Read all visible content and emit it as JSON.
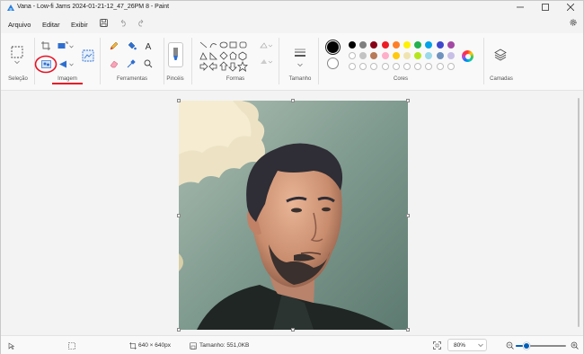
{
  "window": {
    "title": "Vana - Low-fi Jams 2024-01-21-12_47_26PM 8 - Paint"
  },
  "menu": {
    "file": "Arquivo",
    "edit": "Editar",
    "view": "Exibir"
  },
  "ribbon": {
    "groups": {
      "selection": "Seleção",
      "image": "Imagem",
      "tools": "Ferramentas",
      "brushes": "Pincéis",
      "shapes": "Formas",
      "size": "Tamanho",
      "colors": "Cores",
      "layers": "Camadas"
    },
    "text_tool_glyph": "A"
  },
  "palette": {
    "primary": "#000000",
    "secondary": "#ffffff",
    "row1": [
      "#000000",
      "#7f7f7f",
      "#880015",
      "#ed1c24",
      "#ff7f27",
      "#fff200",
      "#22b14c",
      "#00a2e8",
      "#3f48cc",
      "#a349a4"
    ],
    "row2": [
      "#ffffff",
      "#c3c3c3",
      "#b97a57",
      "#ffaec9",
      "#ffc90e",
      "#efe4b0",
      "#b5e61d",
      "#99d9ea",
      "#7092be",
      "#c8bfe7"
    ]
  },
  "status": {
    "dimensions": "640 × 640px",
    "size_label": "Tamanho: 551,0KB",
    "zoom": "80%",
    "zoom_fraction": 0.22
  },
  "accent": "#005fb8",
  "annotation_color": "#e81123"
}
